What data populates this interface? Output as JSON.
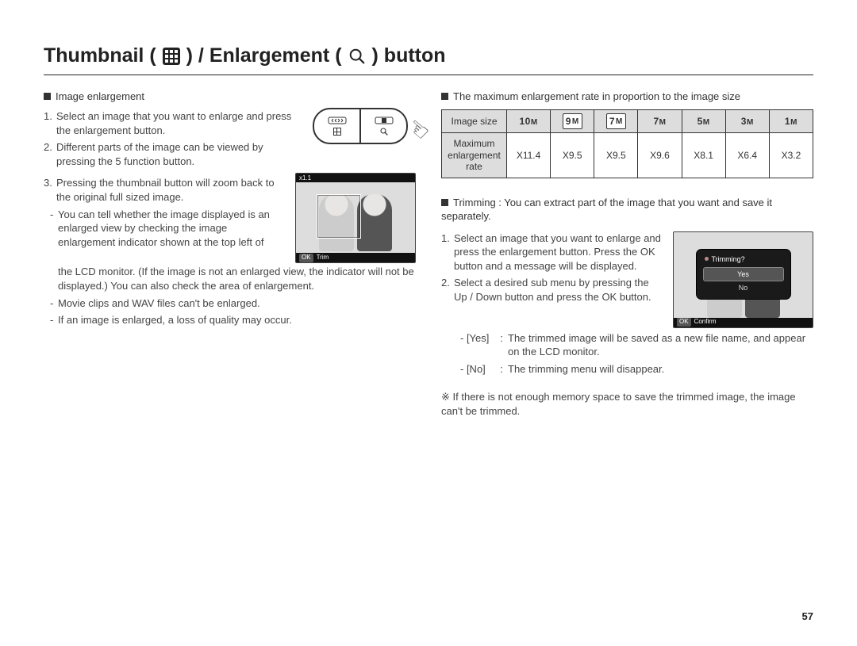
{
  "title": {
    "p1": "Thumbnail (",
    "p2": ") / Enlargement (",
    "p3": ") button"
  },
  "left": {
    "header": "Image enlargement",
    "step1": "Select an image that you want to enlarge and press the enlargement button.",
    "step2": "Different parts of the image can be viewed by pressing the 5 function button.",
    "step3": "Pressing the thumbnail button will zoom back to the original full sized image.",
    "bullet1a": "You can tell whether the image displayed is an enlarged view by checking the image enlargement indicator shown at the top left of",
    "bullet1b": "the LCD monitor. (If the image is not an enlarged view, the indicator will not be displayed.) You can also check the area of enlargement.",
    "bullet2": "Movie clips and WAV files can't be enlarged.",
    "bullet3": "If an image is enlarged, a loss of quality may occur.",
    "lcd1_top": "x1.1",
    "lcd1_foot_btn": "OK",
    "lcd1_foot_label": "Trim",
    "zoom_left_top": "↔↔",
    "zoom_right_top": "[◊]"
  },
  "right": {
    "header1": "The maximum enlargement rate in proportion to the image size",
    "table": {
      "row1_label": "Image size",
      "row2_label": "Maximum enlargement rate",
      "sizes": [
        "10",
        "9",
        "7",
        "7",
        "5",
        "3",
        "1"
      ],
      "size_suffix": "M",
      "boxed": [
        "9",
        "7"
      ],
      "rates": [
        "X11.4",
        "X9.5",
        "X9.5",
        "X9.6",
        "X8.1",
        "X6.4",
        "X3.2"
      ]
    },
    "trim_header": "Trimming : You can extract part of the image that you want and save it separately.",
    "trim_step1": "Select an image that you want to enlarge and press the enlargement button. Press the OK button and a message will be displayed.",
    "trim_step2": "Select a desired sub menu by pressing the Up / Down button and press the OK button.",
    "yes_key": "- [Yes]",
    "yes_txt": "The trimmed image will be saved as a new file name, and appear on the LCD monitor.",
    "no_key": "- [No]",
    "no_txt": "The trimming menu will disappear.",
    "note": "If there is not enough memory space to save the trimmed image, the image can't be trimmed.",
    "lcd2": {
      "question": "Trimming?",
      "yes": "Yes",
      "no": "No",
      "foot_btn": "OK",
      "foot_label": "Confirm"
    }
  },
  "page_number": "57",
  "colon": ":"
}
